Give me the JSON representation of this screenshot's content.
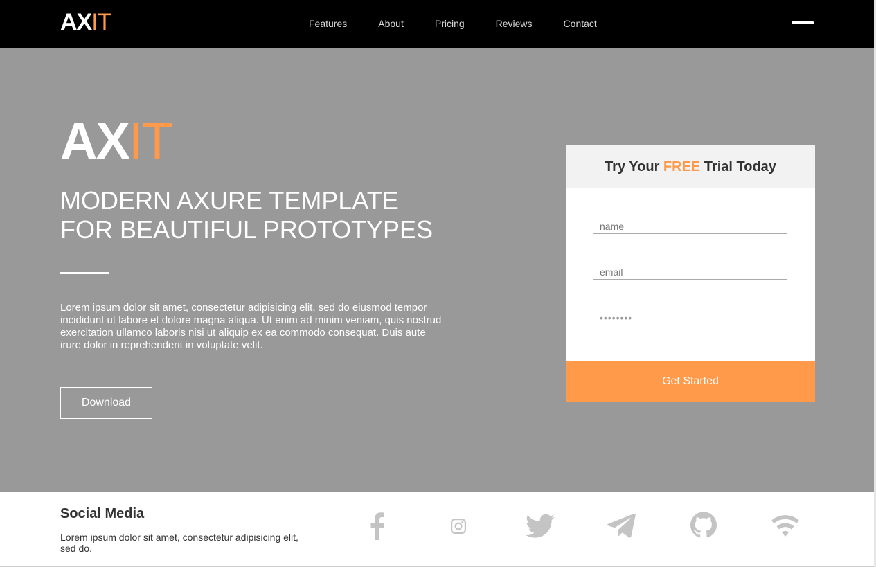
{
  "brand": {
    "logo_bold": "AX",
    "logo_thin": "IT"
  },
  "nav": {
    "items": [
      {
        "label": "Features"
      },
      {
        "label": "About"
      },
      {
        "label": "Pricing"
      },
      {
        "label": "Reviews"
      },
      {
        "label": "Contact"
      }
    ],
    "menu_icon": "hamburger-icon"
  },
  "hero": {
    "headline_line1": "MODERN AXURE TEMPLATE",
    "headline_line2": "FOR BEAUTIFUL PROTOTYPES",
    "description": "Lorem ipsum dolor sit amet, consectetur adipisicing elit, sed do eiusmod tempor incididunt ut labore et dolore magna aliqua. Ut enim ad minim veniam, quis nostrud exercitation ullamco laboris nisi ut aliquip ex ea commodo consequat. Duis aute irure dolor in reprehenderit in voluptate velit.",
    "download_label": "Download"
  },
  "trial_form": {
    "title_prefix": "Try Your ",
    "title_highlight": "FREE",
    "title_suffix": " Trial Today",
    "name_placeholder": "name",
    "email_placeholder": "email",
    "password_value": "password",
    "submit_label": "Get Started"
  },
  "footer": {
    "title": "Social Media",
    "text": "Lorem ipsum dolor sit amet, consectetur adipisicing elit, sed do.",
    "icons": [
      "facebook-icon",
      "instagram-icon",
      "twitter-icon",
      "telegram-icon",
      "github-icon",
      "wifi-icon"
    ]
  },
  "colors": {
    "accent": "#ff9a4a",
    "topbar": "#000000",
    "hero_bg": "#999999",
    "icon_gray": "#c4c4c4"
  }
}
